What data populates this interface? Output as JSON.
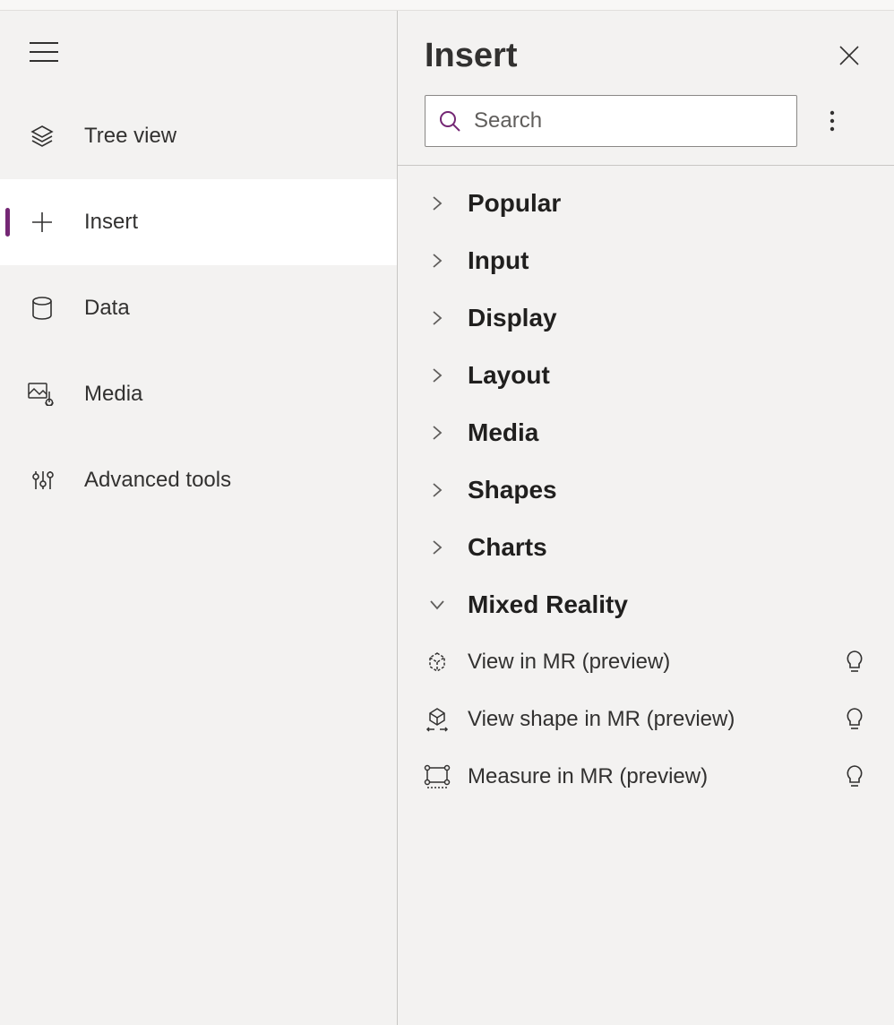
{
  "sidebar": {
    "items": [
      {
        "id": "tree-view",
        "label": "Tree view",
        "active": false
      },
      {
        "id": "insert",
        "label": "Insert",
        "active": true
      },
      {
        "id": "data",
        "label": "Data",
        "active": false
      },
      {
        "id": "media",
        "label": "Media",
        "active": false
      },
      {
        "id": "advanced-tools",
        "label": "Advanced tools",
        "active": false
      }
    ]
  },
  "panel": {
    "title": "Insert",
    "search": {
      "placeholder": "Search",
      "value": ""
    },
    "categories": [
      {
        "id": "popular",
        "label": "Popular",
        "expanded": false
      },
      {
        "id": "input",
        "label": "Input",
        "expanded": false
      },
      {
        "id": "display",
        "label": "Display",
        "expanded": false
      },
      {
        "id": "layout",
        "label": "Layout",
        "expanded": false
      },
      {
        "id": "media",
        "label": "Media",
        "expanded": false
      },
      {
        "id": "shapes",
        "label": "Shapes",
        "expanded": false
      },
      {
        "id": "charts",
        "label": "Charts",
        "expanded": false
      },
      {
        "id": "mixed-reality",
        "label": "Mixed Reality",
        "expanded": true
      }
    ],
    "mixed_reality_items": [
      {
        "id": "view-in-mr",
        "label": "View in MR (preview)"
      },
      {
        "id": "view-shape-in-mr",
        "label": "View shape in MR (preview)"
      },
      {
        "id": "measure-in-mr",
        "label": "Measure in MR (preview)"
      }
    ]
  },
  "colors": {
    "accent": "#742774",
    "text": "#323130",
    "muted": "#605e5c",
    "border": "#c8c6c4",
    "bg": "#f3f2f1"
  }
}
